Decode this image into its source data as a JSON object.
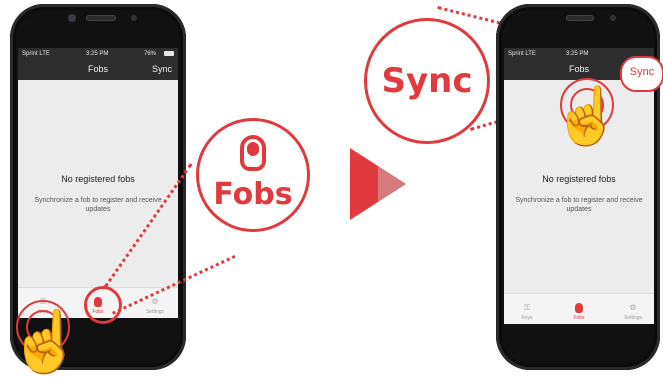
{
  "left_phone": {
    "status": {
      "carrier": "Sprint  LTE",
      "time": "3:25 PM",
      "battery": "76%"
    },
    "nav": {
      "title": "Fobs",
      "sync_label": "Sync"
    },
    "empty": {
      "title": "No registered fobs",
      "message": "Synchronize a fob to register and receive updates"
    },
    "tabs": [
      {
        "label": "Keys"
      },
      {
        "label": "Fobs"
      },
      {
        "label": "Settings"
      }
    ]
  },
  "right_phone": {
    "status": {
      "carrier": "Sprint  LTE",
      "time": "3:25 PM"
    },
    "nav": {
      "title": "Fobs",
      "sync_label": "Sync"
    },
    "empty": {
      "title": "No registered fobs",
      "message": "Synchronize a fob to register and receive updates"
    },
    "tabs": [
      {
        "label": "Keys"
      },
      {
        "label": "Fobs"
      },
      {
        "label": "Settings"
      }
    ]
  },
  "callouts": {
    "fobs": "Fobs",
    "sync": "Sync"
  },
  "icons": {
    "fob": "fob-icon",
    "keys": "keys-icon",
    "settings": "gear-icon",
    "hand": "hand-pointer-icon",
    "arrow": "play-arrow-icon"
  },
  "colors": {
    "accent": "#e03a3e",
    "navbar": "#2d2d2d",
    "screen": "#ececec"
  }
}
